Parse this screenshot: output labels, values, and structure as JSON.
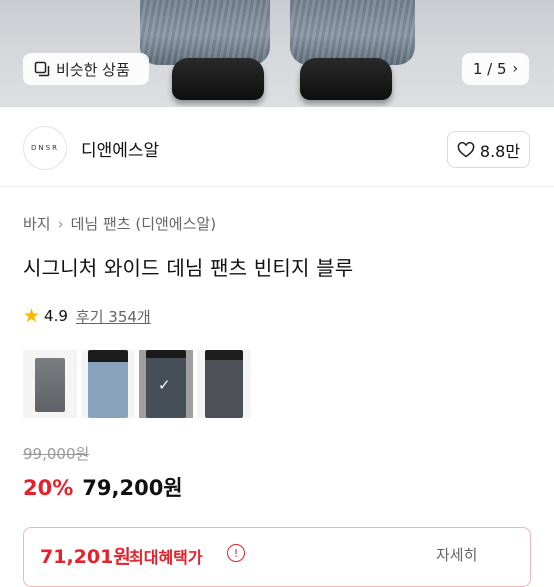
{
  "hero": {
    "similar_button_label": "비슷한 상품",
    "image_counter": "1 / 5"
  },
  "brand": {
    "logo_text": "DNSR",
    "name": "디앤에스알",
    "like_count": "8.8만"
  },
  "breadcrumb": {
    "items": [
      "바지",
      "데님 팬츠 (디앤에스알)"
    ]
  },
  "product": {
    "title": "시그니처 와이드 데님 팬츠 빈티지 블루",
    "rating": "4.9",
    "reviews_label": "후기 354개",
    "thumbnails": [
      {
        "name": "gray-wash",
        "color": "#6f7377"
      },
      {
        "name": "light-blue",
        "color": "#8aa3bd"
      },
      {
        "name": "vintage-blue",
        "color": "#5e6a78",
        "selected": true
      },
      {
        "name": "dark-tint",
        "color": "#4d5056"
      }
    ]
  },
  "price": {
    "original": "99,000원",
    "discount": "20%",
    "sale": "79,200원"
  },
  "benefit": {
    "price": "71,201원",
    "label": "최대혜택가",
    "info_icon": "!",
    "more_label": "자세히"
  },
  "colors": {
    "accent_red": "#e8202a",
    "star": "#f5b700"
  }
}
